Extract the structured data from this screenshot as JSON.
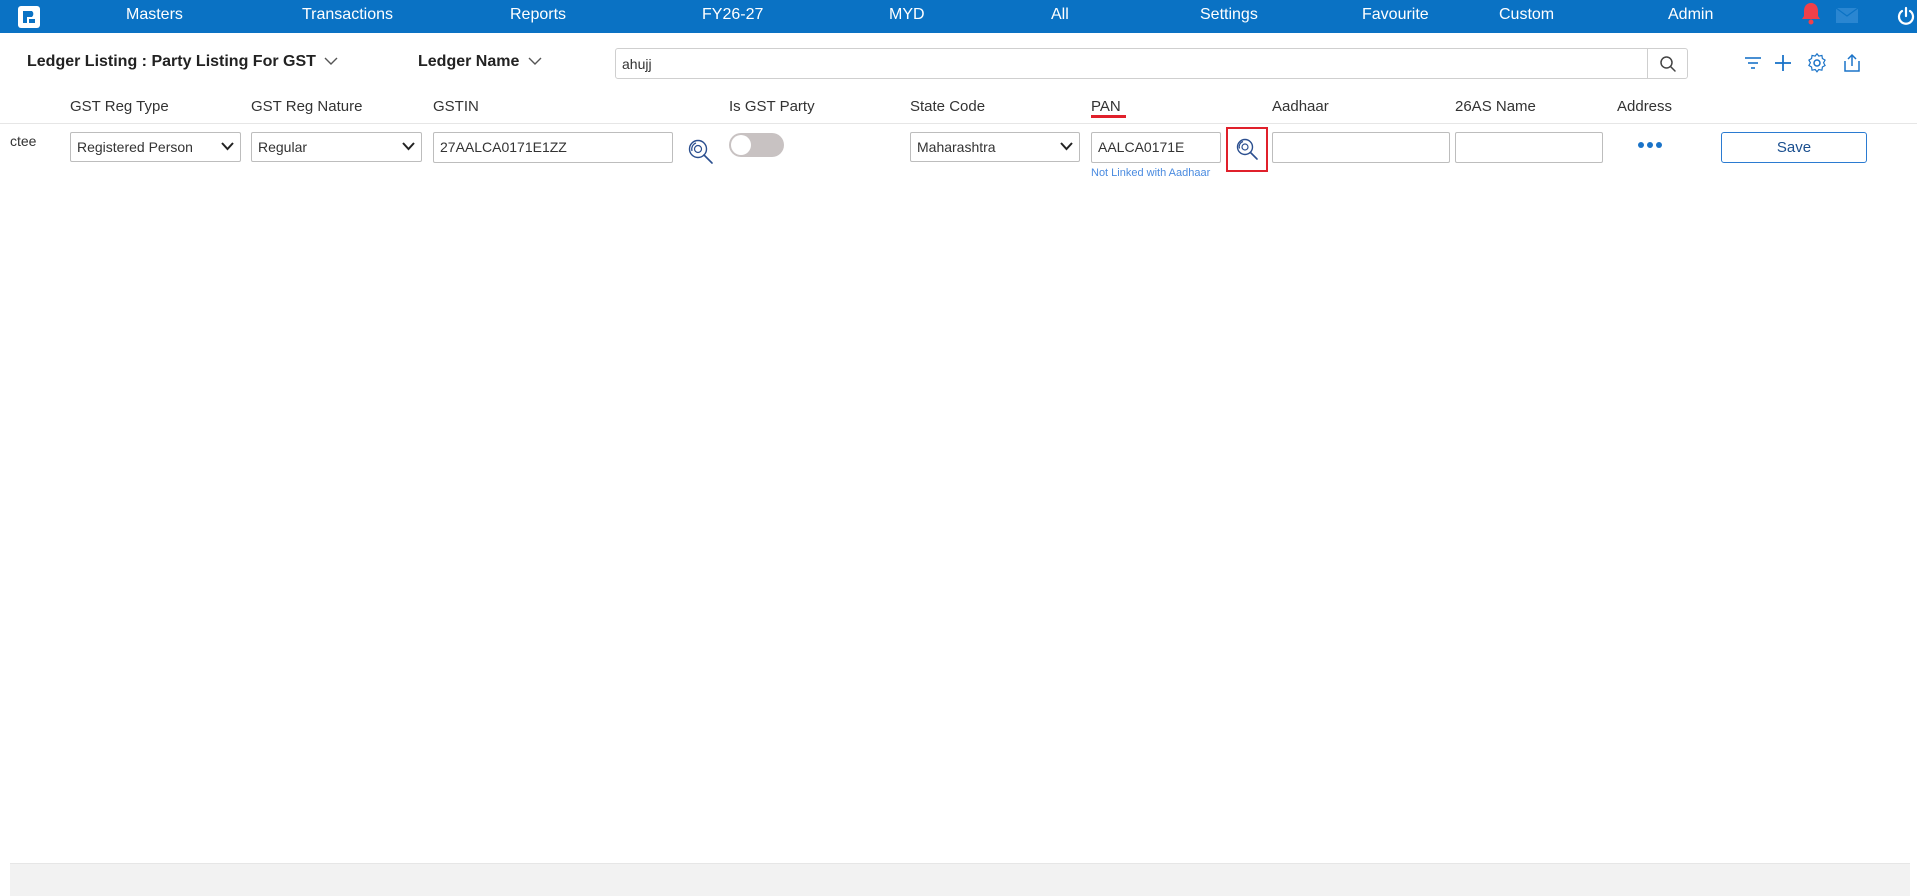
{
  "colors": {
    "nav_bg": "#0a72c4",
    "accent_red": "#e0202b",
    "link_blue": "#4a8be0",
    "toggle_off": "#c8c2c2"
  },
  "nav": {
    "items": [
      {
        "label": "Masters"
      },
      {
        "label": "Transactions"
      },
      {
        "label": "Reports"
      },
      {
        "label": "FY26-27"
      },
      {
        "label": "MYD"
      },
      {
        "label": "All"
      },
      {
        "label": "Settings"
      },
      {
        "label": "Favourite"
      },
      {
        "label": "Custom"
      },
      {
        "label": "Admin"
      }
    ],
    "icons": [
      "app-logo-icon",
      "bell-icon",
      "mail-icon",
      "power-icon"
    ]
  },
  "header": {
    "title": "Ledger Listing : Party Listing For GST",
    "ledger_filter": "Ledger Name",
    "search_value": "ahujj",
    "tool_icons": [
      "search-icon",
      "filter-icon",
      "add-icon",
      "settings-icon",
      "export-icon"
    ]
  },
  "columns": [
    {
      "label": "GST Reg Type"
    },
    {
      "label": "GST Reg Nature"
    },
    {
      "label": "GSTIN"
    },
    {
      "label": "Is GST Party"
    },
    {
      "label": "State Code"
    },
    {
      "label": "PAN"
    },
    {
      "label": "Aadhaar"
    },
    {
      "label": "26AS Name"
    },
    {
      "label": "Address"
    }
  ],
  "row": {
    "label_fragment": "ctee",
    "gst_reg_type": "Registered Person",
    "gst_reg_nature": "Regular",
    "gstin": "27AALCA0171E1ZZ",
    "is_gst_party": false,
    "state_code": "Maharashtra",
    "pan": "AALCA0171E",
    "pan_hint": "Not Linked with Aadhaar",
    "aadhaar": "",
    "name_26as": "",
    "save_label": "Save"
  }
}
